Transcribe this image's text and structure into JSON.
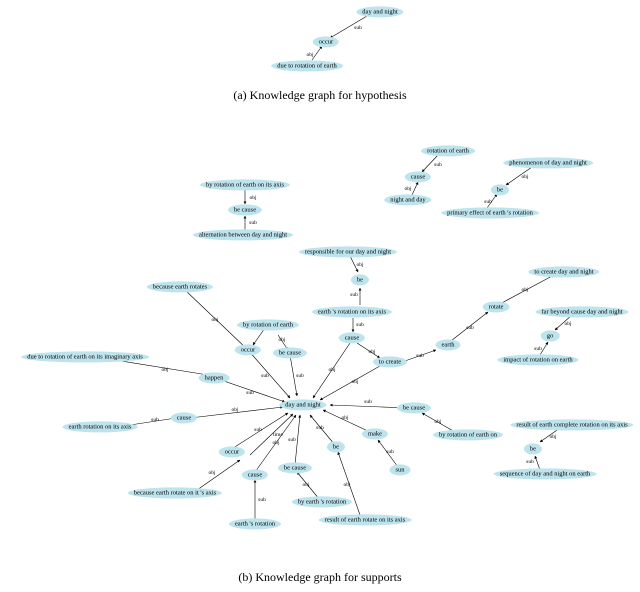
{
  "colors": {
    "node_fill": "#bde3ed"
  },
  "captions": {
    "a": "(a) Knowledge graph for hypothesis",
    "b": "(b) Knowledge graph for supports"
  },
  "graph_a": {
    "nodes": {
      "day_and_night": "day and night",
      "occur": "occur",
      "due_to_rotation": "due to rotation of earth"
    },
    "edges": [
      {
        "from": "day_and_night",
        "to": "occur",
        "label": "sub"
      },
      {
        "from": "due_to_rotation",
        "to": "occur",
        "label": "obj"
      }
    ]
  },
  "graph_b": {
    "nodes": {
      "rotation_of_earth": "rotation of earth",
      "cause_top": "cause",
      "night_and_day": "night and day",
      "phenomenon": "phenomenon of day and night",
      "be_top": "be",
      "primary_effect": "primary effect of earth 's rotation",
      "by_rotation_axis": "by rotation of earth on its axis",
      "be_cause_top": "be cause",
      "alternation": "alternation between day and night",
      "responsible": "responsible for our day and night",
      "be_resp": "be",
      "earth_rotation_axis": "earth 's rotation on its axis",
      "cause_mid": "cause",
      "to_create": "to create",
      "earth": "earth",
      "rotate": "rotate",
      "to_create_dn": "to create day and night",
      "far_beyond": "far beyond cause day and night",
      "go": "go",
      "impact": "impact of rotation on earth",
      "because_rotates": "because earth rotates",
      "by_rotation": "by rotation of earth",
      "occur_mid": "occur",
      "be_cause_mid": "be cause",
      "due_imaginary": "due to rotation of earth on its imaginary axis",
      "happen": "happen",
      "day_and_night": "day and night",
      "be_cause_right": "be cause",
      "by_rotation_on": "by rotation of earth on",
      "make": "make",
      "sun": "sun",
      "be_bottom": "be",
      "by_earth_rotation": "by earth 's rotation",
      "be_cause_bottom": "be cause",
      "cause_bottom": "cause",
      "occur_bottom": "occur",
      "cause_left": "cause",
      "earth_rotation_on_axis": "earth rotation on its axis",
      "because_rotate_axis": "because earth rotate on it 's axis",
      "earth_rotation": "earth 's rotation",
      "result_rotate": "result of earth rotate on its axis",
      "result_complete": "result of earth complete rotation on its axis",
      "be_result": "be",
      "sequence": "sequence of day and night on earth"
    },
    "edge_labels": {
      "sub": "sub",
      "obj": "obj",
      "time": "time"
    }
  }
}
